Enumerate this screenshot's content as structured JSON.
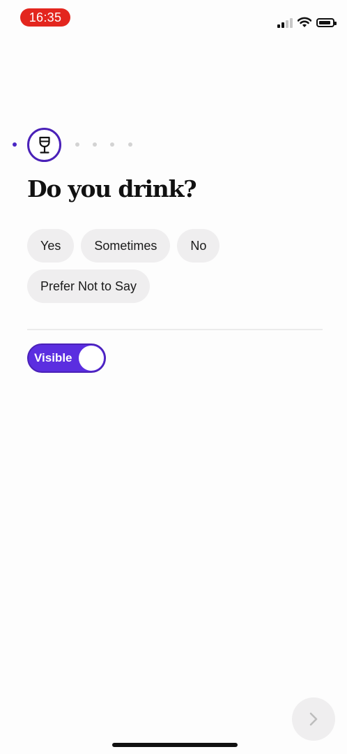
{
  "status_bar": {
    "time": "16:35",
    "time_pill_color": "#e3261e",
    "icons": [
      "cellular-signal-icon",
      "wifi-icon",
      "battery-icon"
    ]
  },
  "progress": {
    "current_step_icon": "wine-glass-icon",
    "accent_color": "#4a21b8"
  },
  "question": {
    "title": "Do you drink?"
  },
  "options": [
    {
      "label": "Yes"
    },
    {
      "label": "Sometimes"
    },
    {
      "label": "No"
    },
    {
      "label": "Prefer Not to Say"
    }
  ],
  "visibility": {
    "label": "Visible",
    "on": true,
    "color": "#5b2ee0"
  },
  "next_button": {
    "icon": "chevron-right-icon",
    "enabled": false
  }
}
